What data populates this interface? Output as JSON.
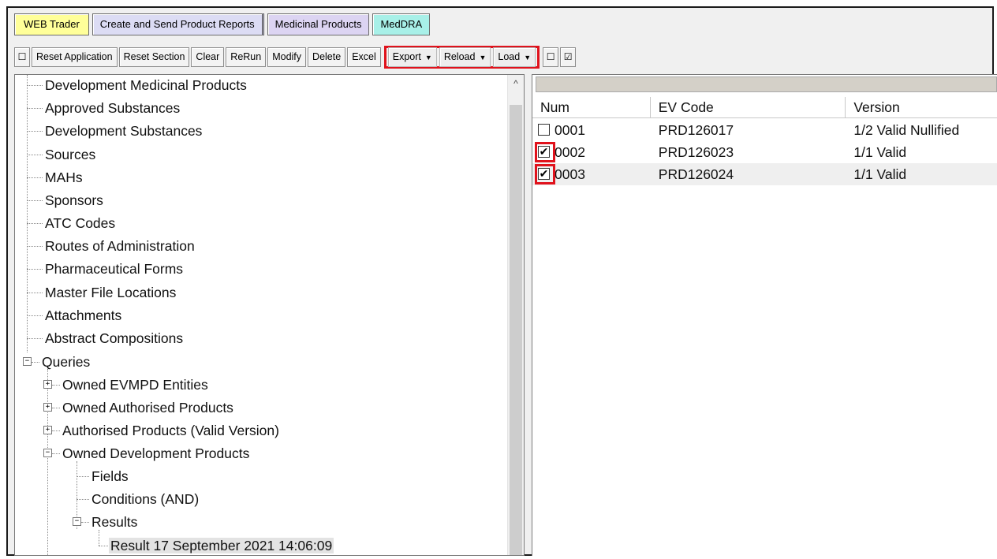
{
  "app_tabs": [
    {
      "label": "WEB Trader"
    },
    {
      "label": "Create and Send Product Reports"
    },
    {
      "label": "Medicinal Products"
    },
    {
      "label": "MedDRA"
    }
  ],
  "toolbar": {
    "toggle_glyph": "☐",
    "reset_application": "Reset Application",
    "reset_section": "Reset Section",
    "clear": "Clear",
    "rerun": "ReRun",
    "modify": "Modify",
    "delete": "Delete",
    "excel": "Excel",
    "export": "Export",
    "reload": "Reload",
    "load": "Load",
    "caret": "▼",
    "uncheck_all_glyph": "☐",
    "check_all_glyph": "☑"
  },
  "tree": {
    "items": [
      "Development Medicinal Products",
      "Approved Substances",
      "Development Substances",
      "Sources",
      "MAHs",
      "Sponsors",
      "ATC Codes",
      "Routes of Administration",
      "Pharmaceutical Forms",
      "Master File Locations",
      "Attachments",
      "Abstract Compositions"
    ],
    "queries": "Queries",
    "owned_evmpd_entities": "Owned EVMPD Entities",
    "owned_authorised_products": "Owned Authorised Products",
    "authorised_valid_version": "Authorised Products (Valid Version)",
    "owned_development_products": "Owned Development Products",
    "fields": "Fields",
    "conditions": "Conditions (AND)",
    "results": "Results",
    "result_item": "Result 17 September 2021 14:06:09",
    "expand_glyph": "+",
    "collapse_glyph": "−",
    "scroll_up": "^"
  },
  "grid": {
    "columns": [
      "Num",
      "EV Code",
      "Version"
    ],
    "rows": [
      {
        "num": "0001",
        "ev_code": "PRD126017",
        "version": "1/2 Valid Nullified",
        "checked": false,
        "check_glyph": ""
      },
      {
        "num": "0002",
        "ev_code": "PRD126023",
        "version": "1/1 Valid",
        "checked": true,
        "check_glyph": "✔"
      },
      {
        "num": "0003",
        "ev_code": "PRD126024",
        "version": "1/1 Valid",
        "checked": true,
        "check_glyph": "✔"
      }
    ]
  },
  "colors": {
    "highlight": "#e0121c",
    "web_trader_tab": "#ffff99",
    "reports_tab": "#dcdcf4",
    "medicinal_tab": "#dcd4f2",
    "meddra_tab": "#a8f0e8"
  }
}
